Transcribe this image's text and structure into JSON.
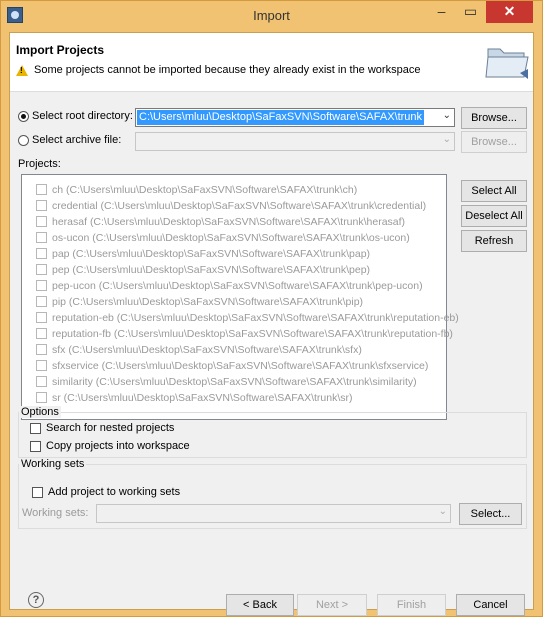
{
  "window": {
    "title": "Import"
  },
  "header": {
    "title": "Import Projects",
    "message": "Some projects cannot be imported because they already exist in the workspace"
  },
  "source": {
    "root_label": "Select root directory:",
    "root_value": "C:\\Users\\mluu\\Desktop\\SaFaxSVN\\Software\\SAFAX\\trunk",
    "archive_label": "Select archive file:",
    "browse_label": "Browse...",
    "browse2_label": "Browse..."
  },
  "projects": {
    "label": "Projects:",
    "items": [
      "ch (C:\\Users\\mluu\\Desktop\\SaFaxSVN\\Software\\SAFAX\\trunk\\ch)",
      "credential (C:\\Users\\mluu\\Desktop\\SaFaxSVN\\Software\\SAFAX\\trunk\\credential)",
      "herasaf (C:\\Users\\mluu\\Desktop\\SaFaxSVN\\Software\\SAFAX\\trunk\\herasaf)",
      "os-ucon (C:\\Users\\mluu\\Desktop\\SaFaxSVN\\Software\\SAFAX\\trunk\\os-ucon)",
      "pap (C:\\Users\\mluu\\Desktop\\SaFaxSVN\\Software\\SAFAX\\trunk\\pap)",
      "pep (C:\\Users\\mluu\\Desktop\\SaFaxSVN\\Software\\SAFAX\\trunk\\pep)",
      "pep-ucon (C:\\Users\\mluu\\Desktop\\SaFaxSVN\\Software\\SAFAX\\trunk\\pep-ucon)",
      "pip (C:\\Users\\mluu\\Desktop\\SaFaxSVN\\Software\\SAFAX\\trunk\\pip)",
      "reputation-eb (C:\\Users\\mluu\\Desktop\\SaFaxSVN\\Software\\SAFAX\\trunk\\reputation-eb)",
      "reputation-fb (C:\\Users\\mluu\\Desktop\\SaFaxSVN\\Software\\SAFAX\\trunk\\reputation-fb)",
      "sfx (C:\\Users\\mluu\\Desktop\\SaFaxSVN\\Software\\SAFAX\\trunk\\sfx)",
      "sfxservice (C:\\Users\\mluu\\Desktop\\SaFaxSVN\\Software\\SAFAX\\trunk\\sfxservice)",
      "similarity (C:\\Users\\mluu\\Desktop\\SaFaxSVN\\Software\\SAFAX\\trunk\\similarity)",
      "sr (C:\\Users\\mluu\\Desktop\\SaFaxSVN\\Software\\SAFAX\\trunk\\sr)"
    ],
    "select_all": "Select All",
    "deselect_all": "Deselect All",
    "refresh": "Refresh"
  },
  "options": {
    "title": "Options",
    "nested": "Search for nested projects",
    "copy": "Copy projects into workspace"
  },
  "working_sets": {
    "title": "Working sets",
    "add": "Add project to working sets",
    "label": "Working sets:",
    "select": "Select..."
  },
  "footer": {
    "help": "?",
    "back": "< Back",
    "next": "Next >",
    "finish": "Finish",
    "cancel": "Cancel"
  },
  "colors": {
    "titlebar": "#f0c271",
    "close": "#c7372f",
    "selection": "#3399ff"
  },
  "icons": [
    "app-icon",
    "warning-icon",
    "folder-icon",
    "help-icon",
    "minimize-icon",
    "maximize-icon",
    "close-icon"
  ]
}
